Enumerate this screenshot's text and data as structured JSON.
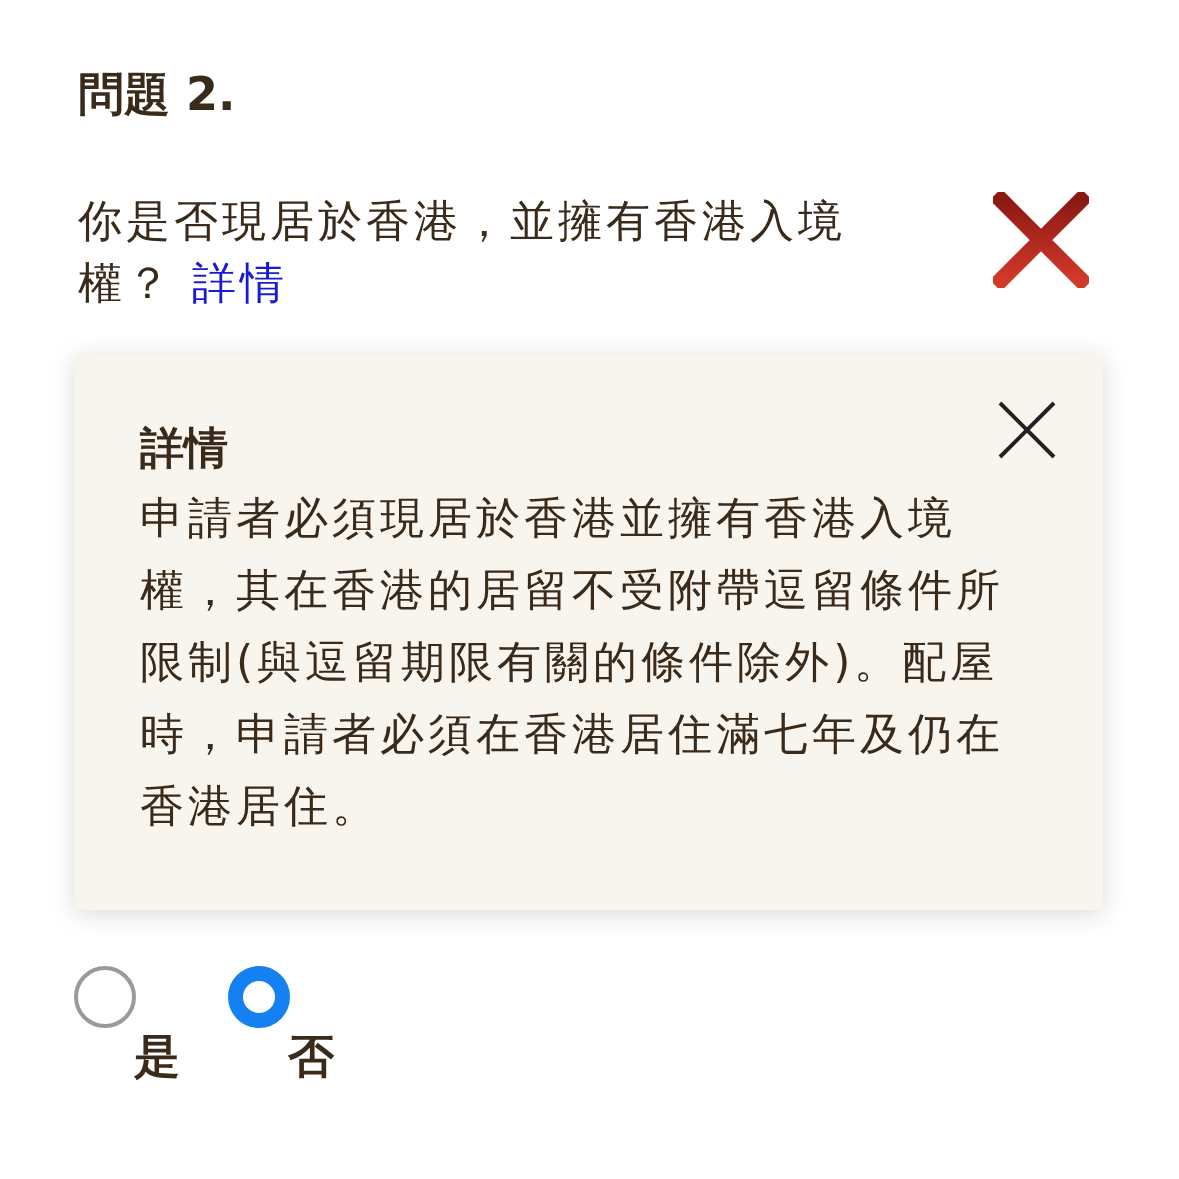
{
  "question": {
    "number": "問題 2.",
    "text": "你是否現居於香港，並擁有香港入境權？",
    "link": "詳情",
    "correct": false
  },
  "details": {
    "title": "詳情",
    "body": "申請者必須現居於香港並擁有香港入境權，其在香港的居留不受附帶逗留條件所限制(與逗留期限有關的條件除外)。配屋時，申請者必須在香港居住滿七年及仍在香港居住。"
  },
  "options": [
    {
      "label": "是",
      "selected": false
    },
    {
      "label": "否",
      "selected": true
    }
  ]
}
